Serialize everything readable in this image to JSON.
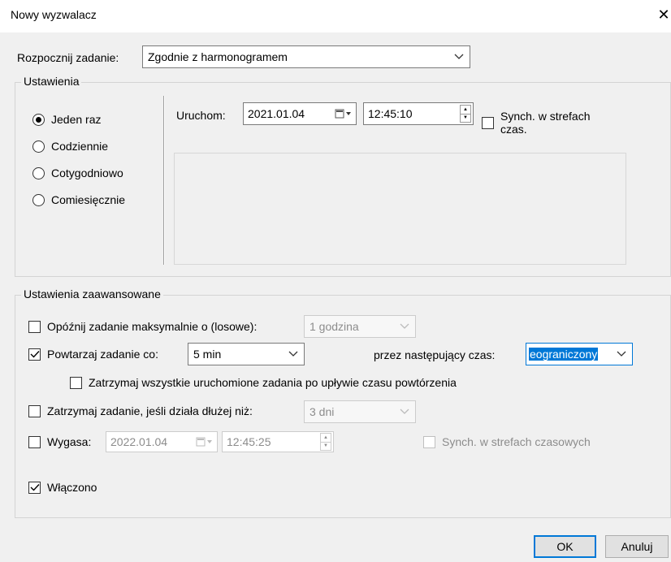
{
  "window": {
    "title": "Nowy wyzwalacz",
    "close_glyph": "✕"
  },
  "start_task": {
    "label": "Rozpocznij zadanie:",
    "value": "Zgodnie z harmonogramem"
  },
  "settings": {
    "group_title": "Ustawienia",
    "radios": [
      {
        "label": "Jeden raz",
        "checked": true
      },
      {
        "label": "Codziennie",
        "checked": false
      },
      {
        "label": "Cotygodniowo",
        "checked": false
      },
      {
        "label": "Comiesięcznie",
        "checked": false
      }
    ],
    "start_label": "Uruchom:",
    "start_date": "2021.01.04",
    "start_time": "12:45:10",
    "sync_label_1": "Synch. w strefach",
    "sync_label_2": "czas.",
    "sync_checked": false
  },
  "advanced": {
    "group_title": "Ustawienia zaawansowane",
    "delay": {
      "label": "Opóźnij zadanie maksymalnie o (losowe):",
      "value": "1 godzina",
      "checked": false
    },
    "repeat": {
      "label": "Powtarzaj zadanie co:",
      "value": "5 min",
      "checked": true,
      "duration_label": "przez następujący czas:",
      "duration_value": "eograniczony"
    },
    "stop_all": {
      "label": "Zatrzymaj wszystkie uruchomione zadania po upływie czasu powtórzenia",
      "checked": false
    },
    "stop_if_longer": {
      "label": "Zatrzymaj zadanie, jeśli działa dłużej niż:",
      "value": "3 dni",
      "checked": false
    },
    "expire": {
      "label": "Wygasa:",
      "date": "2022.01.04",
      "time": "12:45:25",
      "checked": false,
      "sync_label": "Synch. w strefach czasowych",
      "sync_checked": false
    },
    "enabled": {
      "label": "Włączono",
      "checked": true
    }
  },
  "buttons": {
    "ok": "OK",
    "cancel": "Anuluj"
  },
  "colors": {
    "accent": "#0078d7",
    "background": "#f0f0f0"
  }
}
